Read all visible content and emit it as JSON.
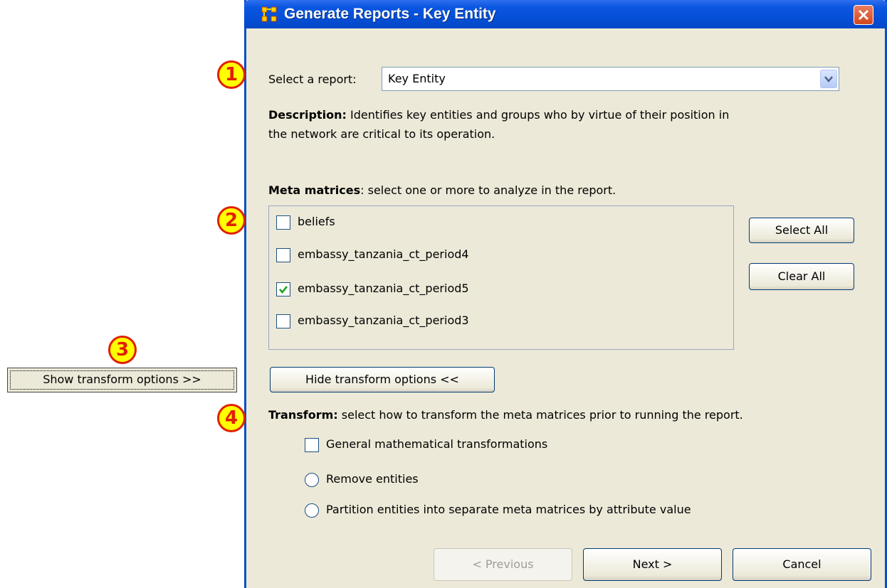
{
  "window": {
    "title": "Generate Reports - Key Entity"
  },
  "callouts": [
    "1",
    "2",
    "3",
    "4"
  ],
  "report": {
    "select_label": "Select a report:",
    "selected": "Key Entity",
    "description_bold": "Description:",
    "description_line1": "Identifies key entities and groups who by virtue of their position in",
    "description_line2": "the network are critical to its operation."
  },
  "meta": {
    "heading_bold": "Meta matrices",
    "heading_rest": ": select one or more to analyze in the report.",
    "items": [
      {
        "label": "beliefs",
        "checked": false
      },
      {
        "label": "embassy_tanzania_ct_period4",
        "checked": false
      },
      {
        "label": "embassy_tanzania_ct_period5",
        "checked": true
      },
      {
        "label": "embassy_tanzania_ct_period3",
        "checked": false
      }
    ],
    "select_all": "Select All",
    "clear_all": "Clear All"
  },
  "transform": {
    "show_button": "Show transform options >>",
    "hide_button": "Hide transform options <<",
    "heading_bold": "Transform:",
    "heading_rest": " select how to transform the meta matrices prior to running the report.",
    "options": [
      {
        "type": "checkbox",
        "label": "General mathematical transformations"
      },
      {
        "type": "radio",
        "label": "Remove entities"
      },
      {
        "type": "radio",
        "label": "Partition entities into separate meta matrices by attribute value"
      }
    ]
  },
  "footer": {
    "previous": "< Previous",
    "next": "Next >",
    "cancel": "Cancel"
  },
  "colors": {
    "title_bar": "#0550d8",
    "window_bg": "#ece9d8",
    "callout_fill": "#ffff00",
    "callout_ring": "#e02000",
    "check": "#21a121"
  }
}
